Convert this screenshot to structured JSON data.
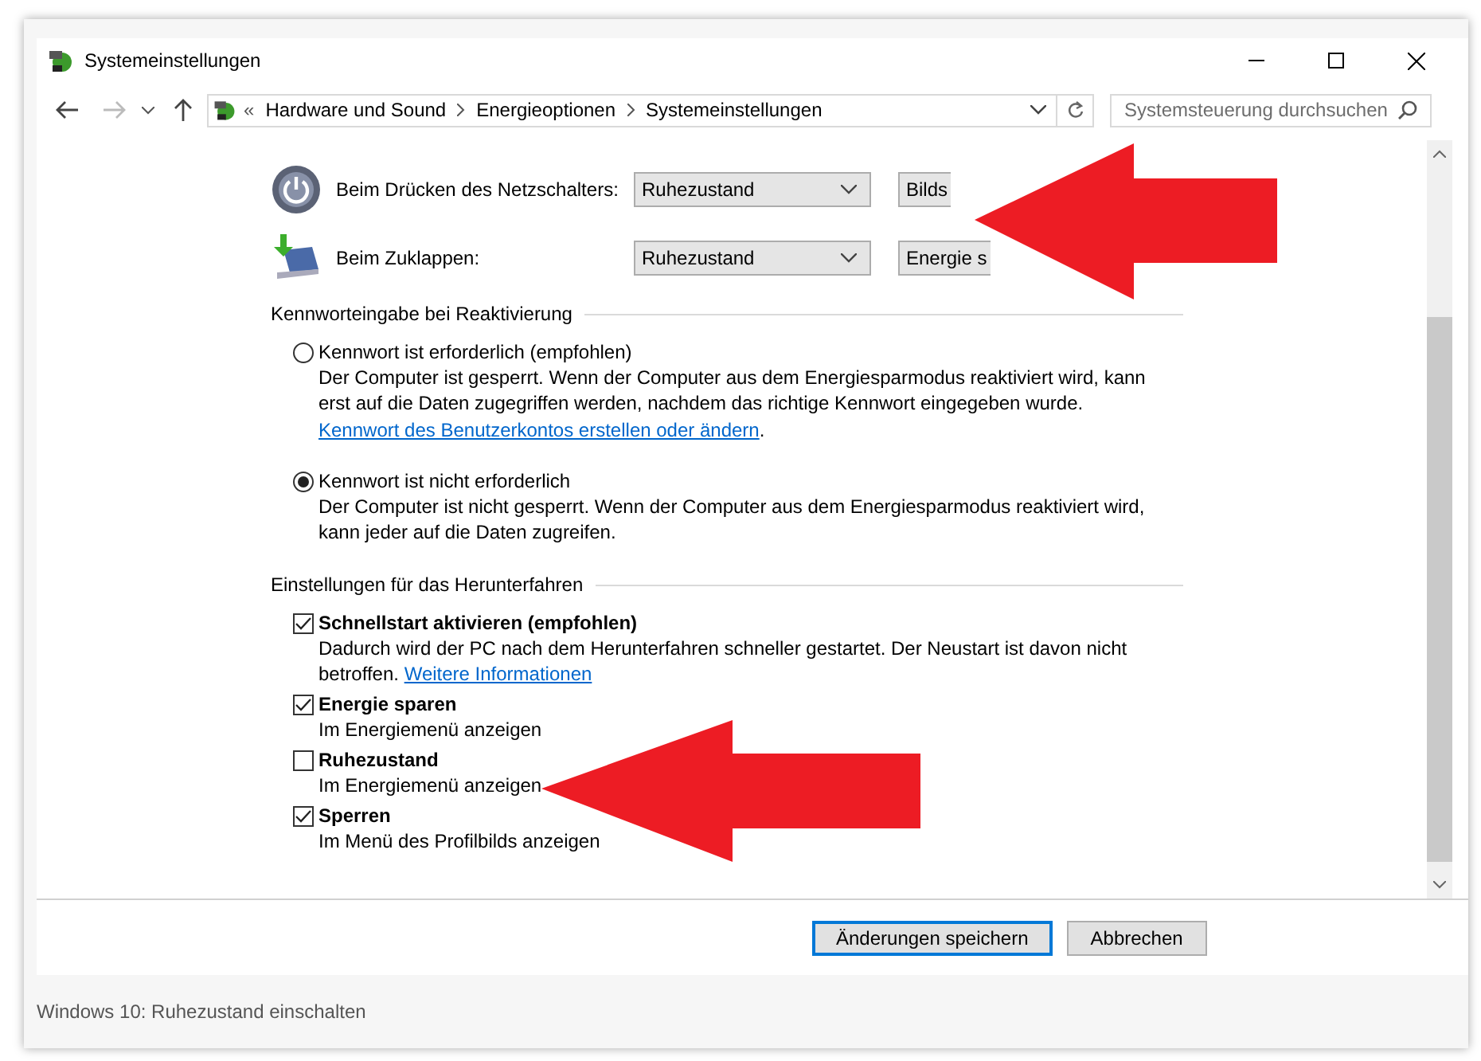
{
  "window": {
    "title": "Systemeinstellungen"
  },
  "address_bar": {
    "overflow": "«",
    "breadcrumbs": [
      "Hardware und Sound",
      "Energieoptionen",
      "Systemeinstellungen"
    ]
  },
  "search": {
    "placeholder": "Systemsteuerung durchsuchen"
  },
  "button_settings": [
    {
      "kind": "power",
      "label": "Beim Drücken des Netzschalters:",
      "on_battery": "Ruhezustand",
      "plugged_in": "Bilds"
    },
    {
      "kind": "lid",
      "label": "Beim Zuklappen:",
      "on_battery": "Ruhezustand",
      "plugged_in": "Energie s"
    }
  ],
  "password_section": {
    "title": "Kennworteingabe bei Reaktivierung",
    "options": [
      {
        "label": "Kennwort ist erforderlich (empfohlen)",
        "selected": false,
        "description": "Der Computer ist gesperrt. Wenn der Computer aus dem Energiesparmodus reaktiviert wird, kann erst auf die Daten zugegriffen werden, nachdem das richtige Kennwort eingegeben wurde.",
        "link": "Kennwort des Benutzerkontos erstellen oder ändern",
        "link_suffix": "."
      },
      {
        "label": "Kennwort ist nicht erforderlich",
        "selected": true,
        "description": "Der Computer ist nicht gesperrt. Wenn der Computer aus dem Energiesparmodus reaktiviert wird, kann jeder auf die Daten zugreifen."
      }
    ]
  },
  "shutdown_section": {
    "title": "Einstellungen für das Herunterfahren",
    "options": [
      {
        "label": "Schnellstart aktivieren (empfohlen)",
        "checked": true,
        "description": "Dadurch wird der PC nach dem Herunterfahren schneller gestartet. Der Neustart ist davon nicht betroffen.",
        "link": "Weitere Informationen"
      },
      {
        "label": "Energie sparen",
        "checked": true,
        "description": "Im Energiemenü anzeigen"
      },
      {
        "label": "Ruhezustand",
        "checked": false,
        "description": "Im Energiemenü anzeigen"
      },
      {
        "label": "Sperren",
        "checked": true,
        "description": "Im Menü des Profilbilds anzeigen"
      }
    ]
  },
  "buttons": [
    {
      "label": "Änderungen speichern",
      "default": true
    },
    {
      "label": "Abbrechen",
      "default": false
    }
  ],
  "caption": "Windows 10: Ruhezustand einschalten",
  "annotations": [
    {
      "kind": "arrow"
    },
    {
      "kind": "arrow"
    }
  ]
}
